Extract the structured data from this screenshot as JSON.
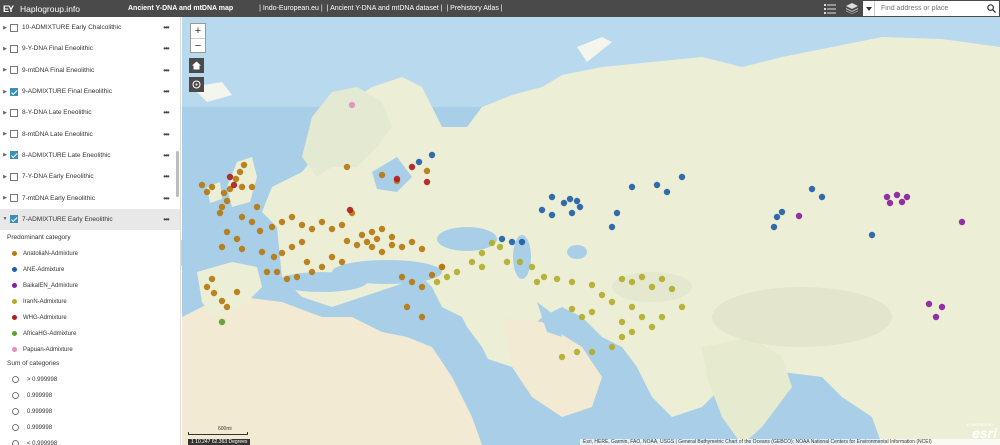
{
  "topbar": {
    "logo": "EY",
    "title": "Haplogroup.info",
    "nav": [
      {
        "label": "Ancient Y-DNA and mtDNA map",
        "bold": true
      },
      {
        "label": "| Indo-European.eu |",
        "bold": false
      },
      {
        "label": "| Ancient Y-DNA and mtDNA dataset |",
        "bold": false
      },
      {
        "label": "| Prehistory Atlas |",
        "bold": false
      }
    ],
    "search_placeholder": "Find address or place"
  },
  "layers": [
    {
      "label": "10-ADMIXTURE Early Chalcolithic",
      "checked": false,
      "expanded": false
    },
    {
      "label": "9-Y-DNA Final Eneolithic",
      "checked": false,
      "expanded": false
    },
    {
      "label": "9-mtDNA Final Eneolithic",
      "checked": false,
      "expanded": false
    },
    {
      "label": "9-ADMIXTURE Final Eneolithic",
      "checked": true,
      "expanded": false
    },
    {
      "label": "8-Y-DNA Late Eneolithic",
      "checked": false,
      "expanded": false
    },
    {
      "label": "8-mtDNA Late Eneolithic",
      "checked": false,
      "expanded": false
    },
    {
      "label": "8-ADMIXTURE Late Eneolithic",
      "checked": true,
      "expanded": false
    },
    {
      "label": "7-Y-DNA Early Eneolithic",
      "checked": false,
      "expanded": false
    },
    {
      "label": "7-mtDNA Early Eneolithic",
      "checked": false,
      "expanded": false
    },
    {
      "label": "7-ADMIXTURE Early Eneolithic",
      "checked": true,
      "expanded": true
    }
  ],
  "legend": {
    "title": "Predominant category",
    "items": [
      {
        "label": "AnatoliaN-Admixture",
        "color": "#b5790f"
      },
      {
        "label": "ANE-Admixture",
        "color": "#1f5fa8"
      },
      {
        "label": "BaikalEN_Admixture",
        "color": "#8a1ea0"
      },
      {
        "label": "IranN-Admixture",
        "color": "#b3ab2c"
      },
      {
        "label": "WHG-Admixture",
        "color": "#b01e1e"
      },
      {
        "label": "AfricaHG-Admixture",
        "color": "#5aa02c"
      },
      {
        "label": "Papuan-Admixture",
        "color": "#e28ec0"
      }
    ],
    "sum_title": "Sum of categories",
    "sum_items": [
      "> 0.999998",
      "0.999998",
      "0.999998",
      "0.999998",
      "< 0.999998"
    ]
  },
  "map": {
    "scale_label": "600mi",
    "coords": "1 10.247 62.363 Degrees",
    "attribution": "Esri, HERE, Garmin, FAO, NOAA, USGS | General Bathymetric Chart of the Oceans (GEBCO); NOAA National Centers for Environmental Information (NCEI)",
    "powered": "POWERED BY",
    "esri": "esri"
  },
  "colors": {
    "topbar": "#4a4a4a",
    "accent": "#3a8fb7",
    "sea": "#a9cfe8",
    "land": "#ecefd6"
  }
}
